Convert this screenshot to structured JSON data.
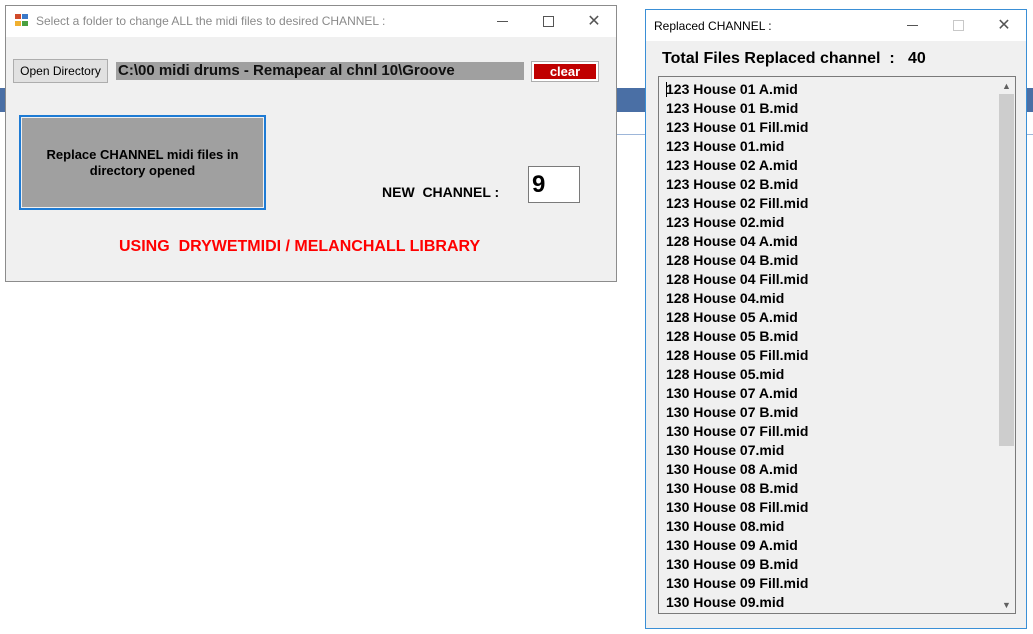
{
  "main_window": {
    "title": "Select a folder to change ALL the midi files to desired CHANNEL :",
    "open_directory_label": "Open Directory",
    "directory_path": "C:\\00 midi drums - Remapear al chnl 10\\Groove",
    "clear_label": "clear",
    "replace_button_label": "Replace CHANNEL midi files in directory opened",
    "new_channel_label": "NEW  CHANNEL :",
    "new_channel_value": "9",
    "library_text": "USING  DRYWETMIDI / MELANCHALL LIBRARY"
  },
  "replaced_window": {
    "title": "Replaced CHANNEL :",
    "total_label": "Total Files Replaced channel  :   40",
    "files": [
      "123 House 01 A.mid",
      "123 House 01 B.mid",
      "123 House 01 Fill.mid",
      "123 House 01.mid",
      "123 House 02 A.mid",
      "123 House 02 B.mid",
      "123 House 02 Fill.mid",
      "123 House 02.mid",
      "128 House 04 A.mid",
      "128 House 04 B.mid",
      "128 House 04 Fill.mid",
      "128 House 04.mid",
      "128 House 05 A.mid",
      "128 House 05 B.mid",
      "128 House 05 Fill.mid",
      "128 House 05.mid",
      "130 House 07 A.mid",
      "130 House 07 B.mid",
      "130 House 07 Fill.mid",
      "130 House 07.mid",
      "130 House 08 A.mid",
      "130 House 08 B.mid",
      "130 House 08 Fill.mid",
      "130 House 08.mid",
      "130 House 09 A.mid",
      "130 House 09 B.mid",
      "130 House 09 Fill.mid",
      "130 House 09.mid"
    ]
  },
  "colors": {
    "accent_border": "#1e7bd4",
    "clear_button": "#c00000",
    "library_text": "#ff0000"
  }
}
